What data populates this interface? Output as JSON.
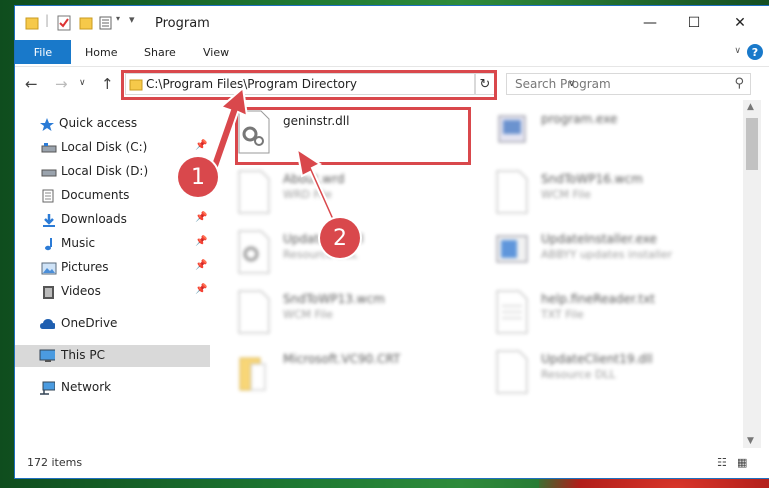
{
  "window": {
    "title": "Program"
  },
  "ribbon": {
    "tabs": [
      "File",
      "Home",
      "Share",
      "View"
    ]
  },
  "address": {
    "path": "C:\\Program Files\\Program Directory"
  },
  "search": {
    "placeholder": "Search Program"
  },
  "nav": {
    "items": [
      {
        "label": "Quick access",
        "icon": "star-icon"
      },
      {
        "label": "Local Disk (C:)",
        "icon": "drive-icon",
        "pinned": true
      },
      {
        "label": "Local Disk (D:)",
        "icon": "drive-icon"
      },
      {
        "label": "Documents",
        "icon": "documents-icon"
      },
      {
        "label": "Downloads",
        "icon": "download-icon",
        "pinned": true
      },
      {
        "label": "Music",
        "icon": "music-icon",
        "pinned": true
      },
      {
        "label": "Pictures",
        "icon": "pictures-icon",
        "pinned": true
      },
      {
        "label": "Videos",
        "icon": "videos-icon",
        "pinned": true
      },
      {
        "label": "OneDrive",
        "icon": "cloud-icon"
      },
      {
        "label": "This PC",
        "icon": "computer-icon",
        "selected": true
      },
      {
        "label": "Network",
        "icon": "network-icon"
      }
    ]
  },
  "files": [
    {
      "name": "geninstr.dll",
      "type": "",
      "highlighted": true
    },
    {
      "name": "program.exe",
      "type": ""
    },
    {
      "name": "About.wrd",
      "type": "WRD File"
    },
    {
      "name": "SndToWP16.wcm",
      "type": "WCM File"
    },
    {
      "name": "Update.21.dll",
      "type": "Resource DLL"
    },
    {
      "name": "UpdateInstaller.exe",
      "type": "ABBYY updates installer"
    },
    {
      "name": "SndToWP13.wcm",
      "type": "WCM File"
    },
    {
      "name": "help.fineReader.txt",
      "type": "TXT File"
    },
    {
      "name": "Microsoft.VC90.CRT",
      "type": ""
    },
    {
      "name": "UpdateClient19.dll",
      "type": "Resource DLL"
    }
  ],
  "status": {
    "item_count": "172 items"
  },
  "annotations": {
    "step1": "1",
    "step2": "2"
  },
  "colors": {
    "accent": "#1979ca",
    "annotation_red": "#d9484c"
  }
}
